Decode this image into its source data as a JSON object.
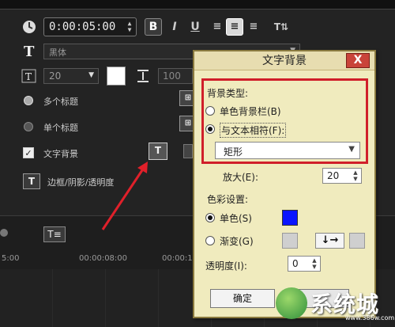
{
  "editor": {
    "timecode": "0:00:05:00",
    "font_name": "黑体",
    "font_size": "20",
    "second_value": "100",
    "multi_title_label": "多个标题",
    "single_title_label": "单个标题",
    "text_background_label": "文字背景",
    "border_shadow_label": "边框/阴影/透明度",
    "text_background_checked": true
  },
  "timeline": {
    "ruler_labels": [
      "5:00",
      "00:00:08:00",
      "00:00:10:00"
    ]
  },
  "dialog": {
    "title": "文字背景",
    "close_label": "X",
    "bg_type_label": "背景类型:",
    "option_single_bar": "单色背景栏(B)",
    "option_fit_text": "与文本相符(F):",
    "fit_text_selected": true,
    "shape_value": "矩形",
    "zoom_label": "放大(E):",
    "zoom_value": "20",
    "color_settings_label": "色彩设置:",
    "option_solid": "单色(S)",
    "option_gradient": "渐变(G)",
    "solid_selected": true,
    "solid_color": "#0a14ff",
    "gradient_direction": "↓→",
    "transparency_label": "透明度(I):",
    "transparency_value": "0",
    "ok_label": "确定"
  },
  "watermark": {
    "brand": "系统城",
    "url": "www.386w.com"
  },
  "colors": {
    "highlight_box": "#d01f2a",
    "dialog_bg": "#f0ebbe"
  }
}
